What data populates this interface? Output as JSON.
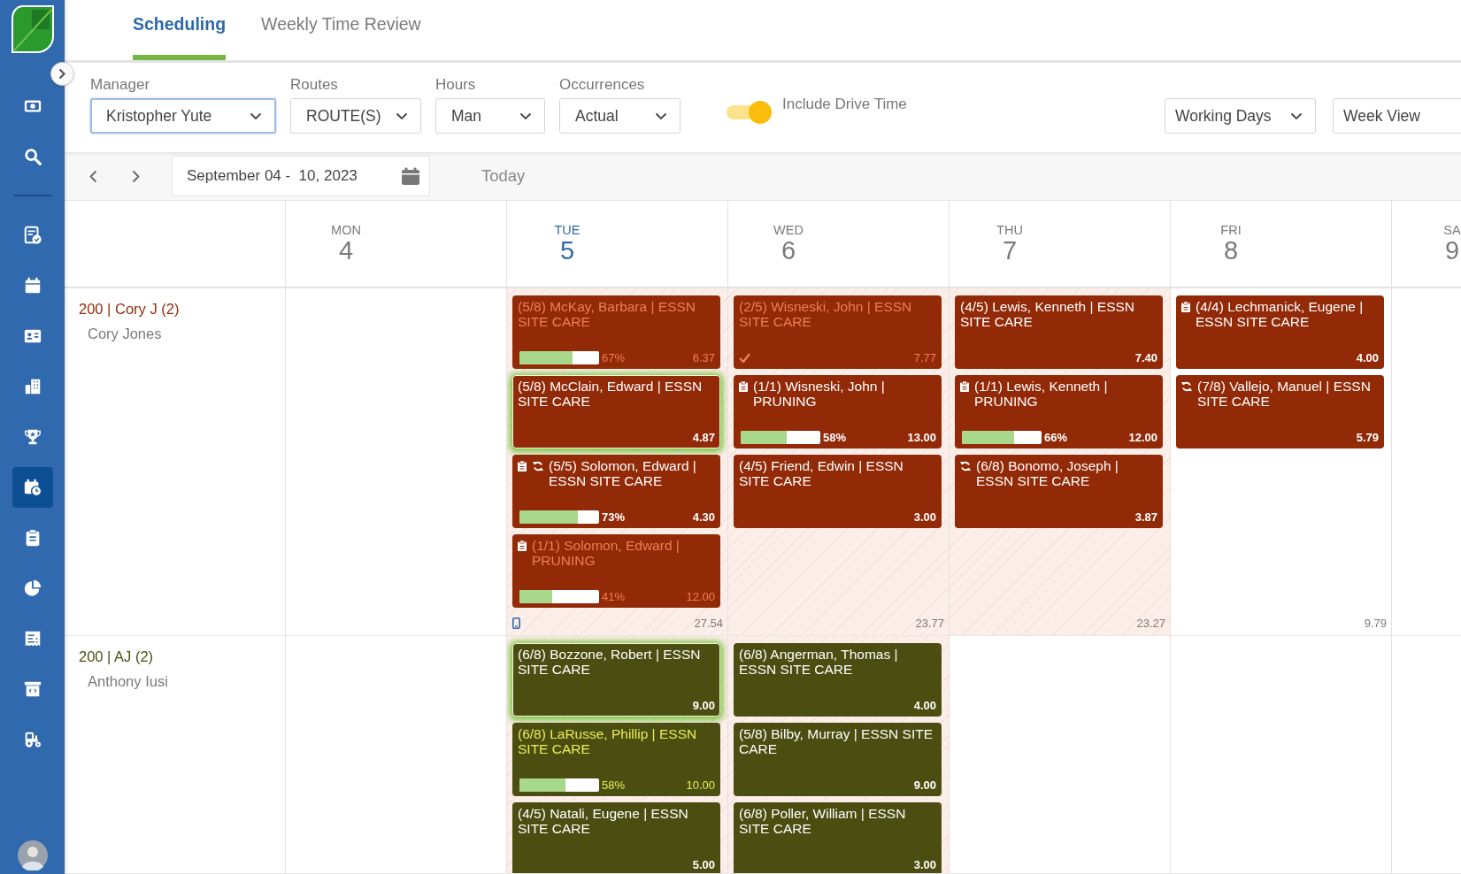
{
  "sidebar": {
    "items": [
      {
        "selected": false
      },
      {
        "selected": false
      },
      {
        "selected": false
      },
      {
        "selected": false
      },
      {
        "selected": false
      },
      {
        "selected": false
      },
      {
        "selected": false
      },
      {
        "selected": true
      },
      {
        "selected": false
      },
      {
        "selected": false
      },
      {
        "selected": false
      },
      {
        "selected": false
      },
      {
        "selected": false
      }
    ]
  },
  "tabs": [
    {
      "label": "Scheduling",
      "selected": true
    },
    {
      "label": "Weekly Time Review",
      "selected": false
    }
  ],
  "filters": {
    "dropdowns": [
      {
        "label": "Manager",
        "value": "Kristopher Yute",
        "focused": true
      },
      {
        "label": "Routes",
        "value": "ROUTE(S)",
        "focused": false
      },
      {
        "label": "Hours",
        "value": "Man",
        "focused": false
      },
      {
        "label": "Occurrences",
        "value": "Actual",
        "focused": false
      }
    ],
    "toggle": {
      "label": "Include Drive Time",
      "on": true
    },
    "view_dropdowns": [
      {
        "value": "Working Days"
      },
      {
        "value": "Week View"
      }
    ]
  },
  "date_nav": {
    "range": "September 04 -  10, 2023",
    "today": "Today"
  },
  "calendar": {
    "days": [
      {
        "name": "MON",
        "date": "4",
        "today": false
      },
      {
        "name": "TUE",
        "date": "5",
        "today": true
      },
      {
        "name": "WED",
        "date": "6",
        "today": false
      },
      {
        "name": "THU",
        "date": "7",
        "today": false
      },
      {
        "name": "FRI",
        "date": "8",
        "today": false
      },
      {
        "name": "SA",
        "date": "9",
        "today": false
      }
    ],
    "rows": [
      {
        "route": "200 | Cory J (2)",
        "name": "Cory Jones",
        "color": "#922a08",
        "cells": [
          {
            "shaded": false,
            "device_icon": false
          },
          {
            "shaded": true,
            "device_icon": true,
            "total": "27.54",
            "cards": [
              {
                "title": "(5/8) McKay, Barbara | ESSN SITE CARE",
                "hours": "6.37",
                "dimmed": true,
                "selected": false,
                "completed": false,
                "progress": {
                  "level": 0.67,
                  "reading": "67%"
                }
              },
              {
                "title": "(5/8) McClain, Edward | ESSN SITE CARE",
                "hours": "4.87",
                "dimmed": false,
                "selected": true,
                "completed": false
              },
              {
                "title": "(5/5) Solomon, Edward | ESSN SITE CARE",
                "hours": "4.30",
                "dimmed": false,
                "selected": false,
                "completed": false,
                "icons": [
                  {
                    "kind": "clipboard"
                  },
                  {
                    "kind": "refresh"
                  }
                ],
                "progress": {
                  "level": 0.73,
                  "reading": "73%"
                }
              },
              {
                "title": "(1/1) Solomon, Edward | PRUNING",
                "hours": "12.00",
                "dimmed": true,
                "selected": false,
                "completed": false,
                "icons": [
                  {
                    "kind": "clipboard"
                  }
                ],
                "progress": {
                  "level": 0.41,
                  "reading": "41%"
                }
              }
            ]
          },
          {
            "shaded": true,
            "device_icon": false,
            "total": "23.77",
            "cards": [
              {
                "title": "(2/5) Wisneski, John | ESSN SITE CARE",
                "hours": "7.77",
                "dimmed": true,
                "selected": false,
                "completed": true
              },
              {
                "title": "(1/1) Wisneski, John | PRUNING",
                "hours": "13.00",
                "dimmed": false,
                "selected": false,
                "completed": false,
                "icons": [
                  {
                    "kind": "clipboard"
                  }
                ],
                "progress": {
                  "level": 0.58,
                  "reading": "58%"
                }
              },
              {
                "title": "(4/5) Friend, Edwin | ESSN SITE CARE",
                "hours": "3.00",
                "dimmed": false,
                "selected": false,
                "completed": false
              }
            ]
          },
          {
            "shaded": true,
            "device_icon": false,
            "total": "23.27",
            "cards": [
              {
                "title": "(4/5) Lewis, Kenneth | ESSN SITE CARE",
                "hours": "7.40",
                "dimmed": false,
                "selected": false,
                "completed": false
              },
              {
                "title": "(1/1) Lewis, Kenneth | PRUNING",
                "hours": "12.00",
                "dimmed": false,
                "selected": false,
                "completed": false,
                "icons": [
                  {
                    "kind": "clipboard"
                  }
                ],
                "progress": {
                  "level": 0.66,
                  "reading": "66%"
                }
              },
              {
                "title": "(6/8) Bonomo, Joseph | ESSN SITE CARE",
                "hours": "3.87",
                "dimmed": false,
                "selected": false,
                "completed": false,
                "icons": [
                  {
                    "kind": "refresh"
                  }
                ]
              }
            ]
          },
          {
            "shaded": false,
            "device_icon": false,
            "total": "9.79",
            "cards": [
              {
                "title": "(4/4) Lechmanick, Eugene | ESSN SITE CARE",
                "hours": "4.00",
                "dimmed": false,
                "selected": false,
                "completed": false,
                "icons": [
                  {
                    "kind": "clipboard"
                  }
                ]
              },
              {
                "title": "(7/8) Vallejo, Manuel | ESSN SITE CARE",
                "hours": "5.79",
                "dimmed": false,
                "selected": false,
                "completed": false,
                "icons": [
                  {
                    "kind": "refresh"
                  }
                ]
              }
            ]
          }
        ]
      },
      {
        "route": "200 | AJ (2)",
        "name": "Anthony Iusi",
        "color": "#4b4e10",
        "cells": [
          {
            "shaded": false,
            "device_icon": false
          },
          {
            "shaded": true,
            "device_icon": false,
            "cards": [
              {
                "title": "(6/8) Bozzone, Robert | ESSN SITE CARE",
                "hours": "9.00",
                "dimmed": false,
                "selected": true,
                "completed": false
              },
              {
                "title": "(6/8) LaRusse, Phillip | ESSN SITE CARE",
                "hours": "10.00",
                "dimmed": true,
                "selected": false,
                "completed": false,
                "progress": {
                  "level": 0.58,
                  "reading": "58%"
                }
              },
              {
                "title": "(4/5) Natali, Eugene | ESSN SITE CARE",
                "hours": "5.00",
                "dimmed": false,
                "selected": false,
                "completed": false
              }
            ]
          },
          {
            "shaded": true,
            "device_icon": false,
            "cards": [
              {
                "title": "(6/8) Angerman, Thomas | ESSN SITE CARE",
                "hours": "4.00",
                "dimmed": false,
                "selected": false,
                "completed": false
              },
              {
                "title": "(5/8) Bilby, Murray | ESSN SITE CARE",
                "hours": "9.00",
                "dimmed": false,
                "selected": false,
                "completed": false
              },
              {
                "title": "(6/8) Poller, William | ESSN SITE CARE",
                "hours": "3.00",
                "dimmed": false,
                "selected": false,
                "completed": false
              }
            ]
          },
          {
            "shaded": false,
            "device_icon": false
          },
          {
            "shaded": false,
            "device_icon": false
          }
        ]
      }
    ]
  }
}
